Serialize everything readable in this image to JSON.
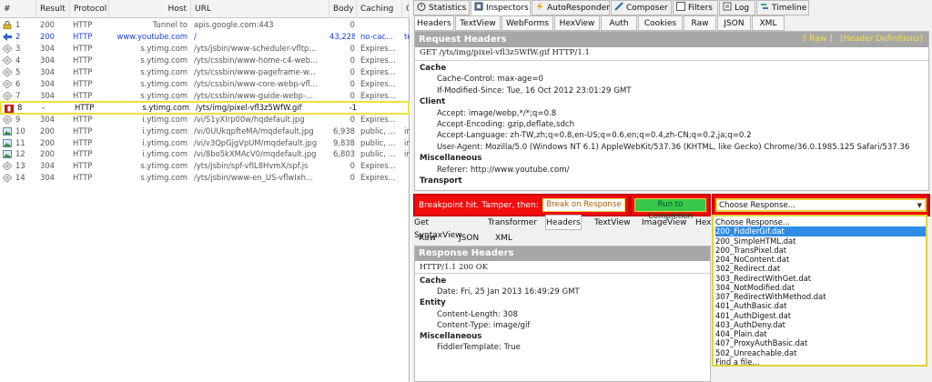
{
  "columns": [
    "#",
    "Result",
    "Protocol",
    "Host",
    "URL",
    "Body",
    "Caching",
    "C"
  ],
  "sessions": [
    {
      "num": "1",
      "result": "200",
      "protocol": "HTTP",
      "host": "Tunnel to",
      "url": "apis.google.com:443",
      "body": "0",
      "caching": "",
      "icon": "lock-icon",
      "style": ""
    },
    {
      "num": "2",
      "result": "200",
      "protocol": "HTTP",
      "host": "www.youtube.com",
      "url": "/",
      "body": "43,228",
      "caching": "no-cac...",
      "icon": "html-icon",
      "style": "blue"
    },
    {
      "num": "3",
      "result": "304",
      "protocol": "HTTP",
      "host": "s.ytimg.com",
      "url": "/yts/jsbin/www-scheduler-vfltp...",
      "body": "0",
      "caching": "Expires...",
      "icon": "diamond-icon",
      "style": ""
    },
    {
      "num": "4",
      "result": "304",
      "protocol": "HTTP",
      "host": "s.ytimg.com",
      "url": "/yts/cssbin/www-home-c4-web...",
      "body": "0",
      "caching": "Expires...",
      "icon": "diamond-icon",
      "style": ""
    },
    {
      "num": "5",
      "result": "304",
      "protocol": "HTTP",
      "host": "s.ytimg.com",
      "url": "/yts/cssbin/www-pageframe-w...",
      "body": "0",
      "caching": "Expires...",
      "icon": "diamond-icon",
      "style": ""
    },
    {
      "num": "6",
      "result": "304",
      "protocol": "HTTP",
      "host": "s.ytimg.com",
      "url": "/yts/cssbin/www-core-webp-vfl...",
      "body": "0",
      "caching": "Expires...",
      "icon": "diamond-icon",
      "style": ""
    },
    {
      "num": "7",
      "result": "304",
      "protocol": "HTTP",
      "host": "s.ytimg.com",
      "url": "/yts/cssbin/www-guide-webp-...",
      "body": "0",
      "caching": "Expires...",
      "icon": "diamond-icon",
      "style": ""
    },
    {
      "num": "8",
      "result": "-",
      "protocol": "HTTP",
      "host": "s.ytimg.com",
      "url": "/yts/img/pixel-vfl3z5WfW.gif",
      "body": "-1",
      "caching": "",
      "icon": "breakpoint-icon",
      "style": "sel"
    },
    {
      "num": "9",
      "result": "304",
      "protocol": "HTTP",
      "host": "i.ytimg.com",
      "url": "/vi/S1yXIrp00w/hqdefault.jpg",
      "body": "0",
      "caching": "Expires...",
      "icon": "diamond-icon",
      "style": ""
    },
    {
      "num": "10",
      "result": "200",
      "protocol": "HTTP",
      "host": "i.ytimg.com",
      "url": "/vi/0UUkqpfteMA/mqdefault.jpg",
      "body": "6,938",
      "caching": "public, ...",
      "icon": "image-icon",
      "style": ""
    },
    {
      "num": "11",
      "result": "200",
      "protocol": "HTTP",
      "host": "i.ytimg.com",
      "url": "/vi/v3QpGjgVpUM/mqdefault.jpg",
      "body": "9,838",
      "caching": "public, ...",
      "icon": "image-icon",
      "style": ""
    },
    {
      "num": "12",
      "result": "200",
      "protocol": "HTTP",
      "host": "i.ytimg.com",
      "url": "/vi/8bo5kXMAcV0/mqdefault.jpg",
      "body": "6,803",
      "caching": "public, ...",
      "icon": "image-icon",
      "style": ""
    },
    {
      "num": "13",
      "result": "304",
      "protocol": "HTTP",
      "host": "s.ytimg.com",
      "url": "/yts/jsbin/spf-vfIL8HvmX/spf.js",
      "body": "0",
      "caching": "Expires...",
      "icon": "diamond-icon",
      "style": ""
    },
    {
      "num": "14",
      "result": "304",
      "protocol": "HTTP",
      "host": "s.ytimg.com",
      "url": "/yts/jsbin/www-en_US-vflwIxh...",
      "body": "0",
      "caching": "Expires...",
      "icon": "diamond-icon",
      "style": ""
    }
  ],
  "main_tabs": [
    "Statistics",
    "Inspectors",
    "AutoResponder",
    "Composer",
    "Filters",
    "Log",
    "Timeline"
  ],
  "request_tabs": [
    "Headers",
    "TextView",
    "WebForms",
    "HexView",
    "Auth",
    "Cookies",
    "Raw",
    "JSON",
    "XML"
  ],
  "request": {
    "title": "Request Headers",
    "raw_link": "[ Raw ]",
    "defs_link": "[Header Definitions]",
    "request_line": "GET /yts/img/pixel-vfl3z5WfW.gif HTTP/1.1",
    "groups": [
      {
        "name": "Cache",
        "lines": [
          "Cache-Control: max-age=0",
          "If-Modified-Since: Tue, 16 Oct 2012 23:01:29 GMT"
        ]
      },
      {
        "name": "Client",
        "lines": [
          "Accept: image/webp,*/*;q=0.8",
          "Accept-Encoding: gzip,deflate,sdch",
          "Accept-Language: zh-TW,zh;q=0.8,en-US;q=0.6,en;q=0.4,zh-CN;q=0.2,ja;q=0.2",
          "User-Agent: Mozilla/5.0 (Windows NT 6.1) AppleWebKit/537.36 (KHTML, like Gecko) Chrome/36.0.1985.125 Safari/537.36"
        ]
      },
      {
        "name": "Miscellaneous",
        "lines": [
          "Referer: http://www.youtube.com/"
        ]
      },
      {
        "name": "Transport",
        "lines": []
      }
    ]
  },
  "breakpoint": {
    "message": "Breakpoint hit. Tamper, then:",
    "break_on_response": "Break on Response",
    "run_to_completion": "Run to Completion",
    "choose_response": "Choose Response..."
  },
  "response_tabs_row1": [
    "Get SyntaxView",
    "Transformer",
    "Headers",
    "TextView",
    "ImageView",
    "HexV"
  ],
  "response_tabs_row2": [
    "Raw",
    "JSON",
    "XML"
  ],
  "response": {
    "title": "Response Headers",
    "status_line": "HTTP/1.1 200 OK",
    "groups": [
      {
        "name": "Cache",
        "lines": [
          "Date: Fri, 25 Jan 2013 16:49:29 GMT"
        ]
      },
      {
        "name": "Entity",
        "lines": [
          "Content-Length: 308",
          "Content-Type: image/gif"
        ]
      },
      {
        "name": "Miscellaneous",
        "lines": [
          "FiddlerTemplate: True"
        ]
      }
    ]
  },
  "response_options": [
    "Choose Response...",
    "200_FiddlerGif.dat",
    "200_SimpleHTML.dat",
    "200_TransPixel.dat",
    "204_NoContent.dat",
    "302_Redirect.dat",
    "303_RedirectWithGet.dat",
    "304_NotModified.dat",
    "307_RedirectWithMethod.dat",
    "401_AuthBasic.dat",
    "401_AuthDigest.dat",
    "403_AuthDeny.dat",
    "404_Plain.dat",
    "407_ProxyAuthBasic.dat",
    "502_Unreachable.dat",
    "Find a file..."
  ],
  "selected_option_index": 1,
  "colors": {
    "breakpoint_red": "#f20d0d",
    "highlight_yellow": "#f1df3c",
    "run_green": "#37c84a",
    "selection_blue": "#2f8ce6",
    "header_gray": "#a7a7a7"
  }
}
